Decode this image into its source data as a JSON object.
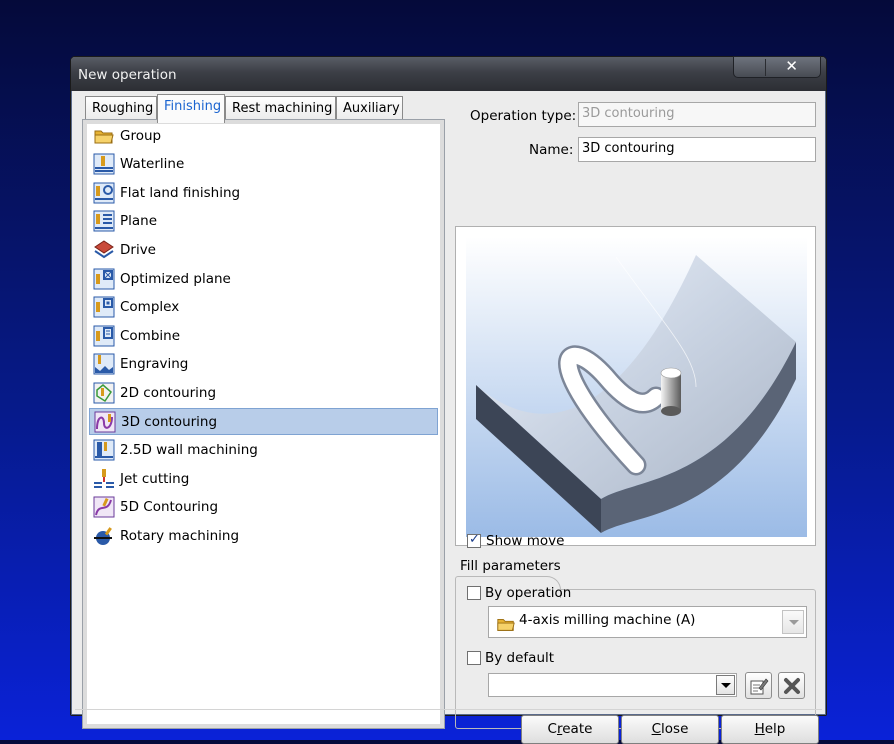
{
  "window": {
    "title": "New operation",
    "close_glyph": "✕"
  },
  "tabs": [
    {
      "label": "Roughing",
      "active": false
    },
    {
      "label": "Finishing",
      "active": true
    },
    {
      "label": "Rest machining",
      "active": false
    },
    {
      "label": "Auxiliary",
      "active": false
    }
  ],
  "operations": [
    {
      "label": "Group",
      "icon": "folder-icon"
    },
    {
      "label": "Waterline",
      "icon": "waterline-icon"
    },
    {
      "label": "Flat land finishing",
      "icon": "flat-land-icon"
    },
    {
      "label": "Plane",
      "icon": "plane-icon"
    },
    {
      "label": "Drive",
      "icon": "drive-icon"
    },
    {
      "label": "Optimized plane",
      "icon": "optimized-plane-icon"
    },
    {
      "label": "Complex",
      "icon": "complex-icon"
    },
    {
      "label": "Combine",
      "icon": "combine-icon"
    },
    {
      "label": "Engraving",
      "icon": "engraving-icon"
    },
    {
      "label": "2D contouring",
      "icon": "2d-contouring-icon"
    },
    {
      "label": "3D contouring",
      "icon": "3d-contouring-icon",
      "selected": true
    },
    {
      "label": "2.5D wall machining",
      "icon": "wall-machining-icon"
    },
    {
      "label": "Jet cutting",
      "icon": "jet-cutting-icon"
    },
    {
      "label": "5D Contouring",
      "icon": "5d-contouring-icon"
    },
    {
      "label": "Rotary machining",
      "icon": "rotary-machining-icon"
    }
  ],
  "form": {
    "operation_type_label": "Operation type:",
    "operation_type_value": "3D contouring",
    "name_label": "Name:",
    "name_value": "3D contouring"
  },
  "show_move": {
    "label": "Show move",
    "checked": true
  },
  "fill_parameters": {
    "title": "Fill parameters",
    "by_operation": {
      "label": "By operation",
      "checked": false,
      "value": "4-axis milling machine (A)"
    },
    "by_default": {
      "label": "By default",
      "checked": false,
      "value": ""
    }
  },
  "buttons": {
    "create": {
      "pre": "C",
      "accel": "r",
      "post": "eate"
    },
    "close": {
      "pre": "",
      "accel": "C",
      "post": "lose"
    },
    "help": {
      "pre": "",
      "accel": "H",
      "post": "elp"
    }
  },
  "colors": {
    "accent": "#1a64d0",
    "selection": "#b8cde9",
    "title_bar": "#3c3f46"
  }
}
